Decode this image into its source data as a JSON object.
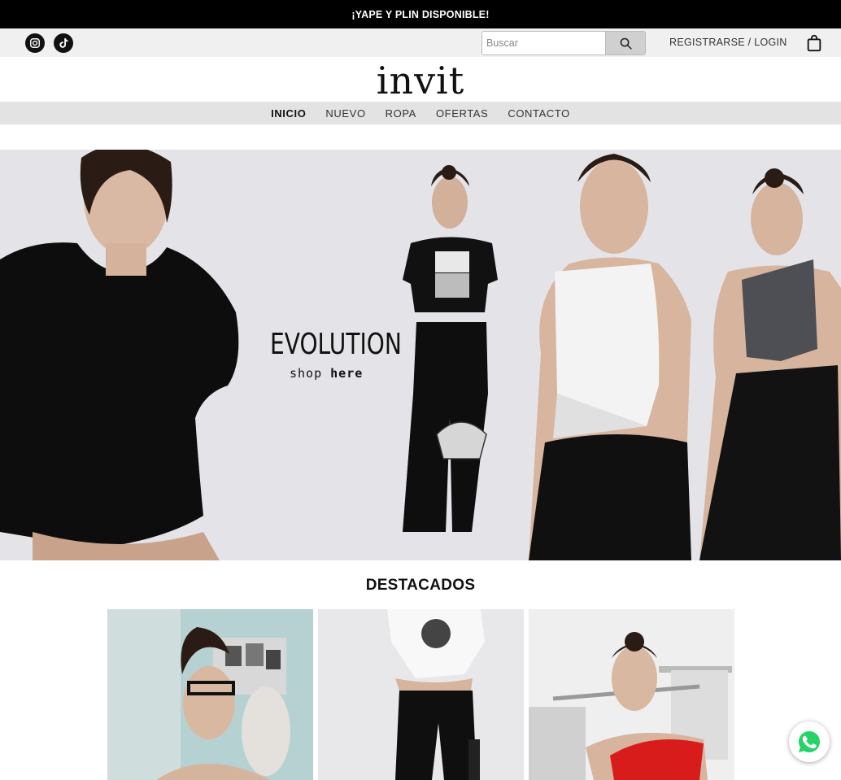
{
  "promo": {
    "text": "¡YAPE Y PLIN DISPONIBLE!"
  },
  "header": {
    "social": [
      {
        "name": "instagram-icon"
      },
      {
        "name": "tiktok-icon"
      }
    ],
    "search": {
      "placeholder": "Buscar",
      "value": "",
      "icon": "search-icon"
    },
    "account_link": "REGISTRARSE / LOGIN",
    "cart_icon": "shopping-bag-icon"
  },
  "brand": {
    "logo": "invit"
  },
  "nav": {
    "items": [
      {
        "label": "INICIO",
        "active": true
      },
      {
        "label": "NUEVO",
        "active": false
      },
      {
        "label": "ROPA",
        "active": false
      },
      {
        "label": "OFERTAS",
        "active": false
      },
      {
        "label": "CONTACTO",
        "active": false
      }
    ]
  },
  "hero": {
    "title": "EVOLUTION",
    "subtitle_prefix": "shop",
    "subtitle_strong": "here"
  },
  "featured": {
    "title": "DESTACADOS",
    "products": [
      {
        "image": "model-glasses-photo"
      },
      {
        "image": "model-white-crop-top-photo"
      },
      {
        "image": "model-red-top-photo"
      }
    ]
  },
  "floating": {
    "whatsapp_icon": "whatsapp-icon"
  },
  "colors": {
    "promo_bg": "#000000",
    "util_bg": "#f0f0f0",
    "nav_bg": "#e3e3e3",
    "hero_bg": "#e4e4e8",
    "whatsapp_green": "#25d366"
  }
}
